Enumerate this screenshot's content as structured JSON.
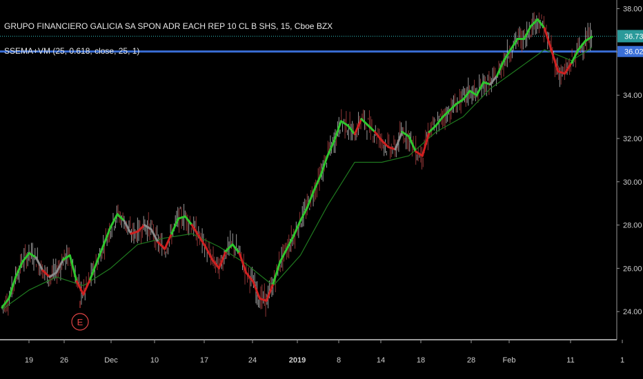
{
  "header": {
    "symbol_title": "GRUPO FINANCIERO GALICIA SA SPON ADR EACH REP 10 CL B SHS, 15, Cboe BZX",
    "indicator_title": "SSEMA+VM (25, 0.618, close, 25, 1)"
  },
  "price_tags": {
    "last": "36.73",
    "level": "36.02"
  },
  "colors": {
    "background": "#000000",
    "grid": "#1a1a1a",
    "axis_text": "#d0d0d0",
    "candle_up": "#cfcfcf",
    "candle_down": "#c04848",
    "ssema_up": "#2ec82e",
    "ssema_down": "#d02020",
    "ssema_flat": "#8a8a8a",
    "slow_line": "#1f7a1f",
    "blue_line": "#3a6fd8",
    "dotted_line": "#2fbfbf",
    "tag_last": "#2a9a9a",
    "tag_level": "#3a6fd8",
    "marker": "#e04444"
  },
  "chart_data": {
    "type": "line",
    "title": "GRUPO FINANCIERO GALICIA SA SPON ADR EACH REP 10 CL B SHS, 15, Cboe BZX",
    "xlabel": "",
    "ylabel": "",
    "ylim": [
      22.7,
      38.4
    ],
    "y_ticks": [
      "24.00",
      "26.00",
      "28.00",
      "30.00",
      "32.00",
      "34.00",
      "36.00",
      "38.00"
    ],
    "x_ticks": [
      "19",
      "26",
      "Dec",
      "10",
      "17",
      "24",
      "2019",
      "8",
      "14",
      "18",
      "28",
      "Feb",
      "11",
      "1"
    ],
    "x_tick_bold": [
      false,
      false,
      false,
      false,
      false,
      false,
      true,
      false,
      false,
      false,
      false,
      false,
      false,
      false
    ],
    "grid": false,
    "horizontal_levels": [
      {
        "value": 36.73,
        "style": "dotted"
      },
      {
        "value": 36.02,
        "style": "solid"
      }
    ],
    "event_marker": {
      "label": "E",
      "x": 11.5
    },
    "series": [
      {
        "x": [
          0,
          1,
          2,
          3,
          4,
          5,
          6,
          7,
          8,
          9,
          10,
          11,
          12,
          13,
          14,
          15,
          16,
          17,
          18,
          19,
          20,
          21,
          22,
          23,
          24,
          25,
          26,
          27,
          28,
          29,
          30,
          31,
          32,
          33,
          34,
          35,
          36,
          37,
          38,
          39,
          40,
          41,
          42,
          43,
          44,
          45,
          46,
          47,
          48,
          49,
          50,
          51,
          52,
          53,
          54,
          55,
          56,
          57,
          58,
          59,
          60,
          61,
          62,
          63,
          64,
          65,
          66,
          67,
          68,
          69,
          70,
          71,
          72,
          73,
          74,
          75,
          76,
          77,
          78,
          79,
          80,
          81,
          82,
          83,
          84,
          85,
          86,
          87
        ],
        "values": [
          24.2,
          24.6,
          25.6,
          26.3,
          26.7,
          26.5,
          25.9,
          25.6,
          25.8,
          26.4,
          26.6,
          25.4,
          24.8,
          25.5,
          26.3,
          27.1,
          27.9,
          28.5,
          28.2,
          27.6,
          27.7,
          28.0,
          27.8,
          27.2,
          26.9,
          27.6,
          28.3,
          28.4,
          28.0,
          27.5,
          27.0,
          26.4,
          26.0,
          26.8,
          27.1,
          26.7,
          25.8,
          25.4,
          24.6,
          24.5,
          25.3,
          26.3,
          26.9,
          27.5,
          28.2,
          28.8,
          29.6,
          30.3,
          31.2,
          31.9,
          32.8,
          32.6,
          32.2,
          32.9,
          32.6,
          32.3,
          31.9,
          31.6,
          31.5,
          32.3,
          32.1,
          31.4,
          31.2,
          32.3,
          32.6,
          33.0,
          33.3,
          33.6,
          33.8,
          34.2,
          34.0,
          34.6,
          34.5,
          34.9,
          35.6,
          36.1,
          36.6,
          36.6,
          37.2,
          37.5,
          37.1,
          36.1,
          35.1,
          35.0,
          35.5,
          36.1,
          36.5,
          36.7
        ],
        "trend": [
          "u",
          "u",
          "u",
          "u",
          "u",
          "f",
          "d",
          "f",
          "f",
          "u",
          "u",
          "d",
          "d",
          "u",
          "u",
          "u",
          "u",
          "u",
          "f",
          "d",
          "d",
          "f",
          "f",
          "d",
          "d",
          "u",
          "u",
          "u",
          "d",
          "d",
          "d",
          "d",
          "d",
          "u",
          "u",
          "d",
          "d",
          "d",
          "d",
          "d",
          "u",
          "u",
          "u",
          "u",
          "u",
          "u",
          "u",
          "u",
          "u",
          "u",
          "u",
          "u",
          "d",
          "u",
          "u",
          "d",
          "d",
          "d",
          "f",
          "u",
          "u",
          "d",
          "d",
          "u",
          "u",
          "u",
          "u",
          "u",
          "u",
          "u",
          "u",
          "u",
          "f",
          "u",
          "u",
          "u",
          "u",
          "u",
          "u",
          "u",
          "d",
          "d",
          "d",
          "d",
          "u",
          "u",
          "u",
          "u"
        ]
      },
      {
        "x": [
          0,
          4,
          8,
          12,
          16,
          20,
          24,
          28,
          32,
          36,
          40,
          44,
          48,
          52,
          56,
          60,
          64,
          68,
          72,
          76,
          80,
          84,
          87
        ],
        "values": [
          24.1,
          25.0,
          25.6,
          25.2,
          26.0,
          27.1,
          27.4,
          27.6,
          27.0,
          26.2,
          25.2,
          26.6,
          28.9,
          30.9,
          30.9,
          31.2,
          32.3,
          33.0,
          34.3,
          35.2,
          36.1,
          35.6,
          36.2
        ]
      }
    ]
  }
}
